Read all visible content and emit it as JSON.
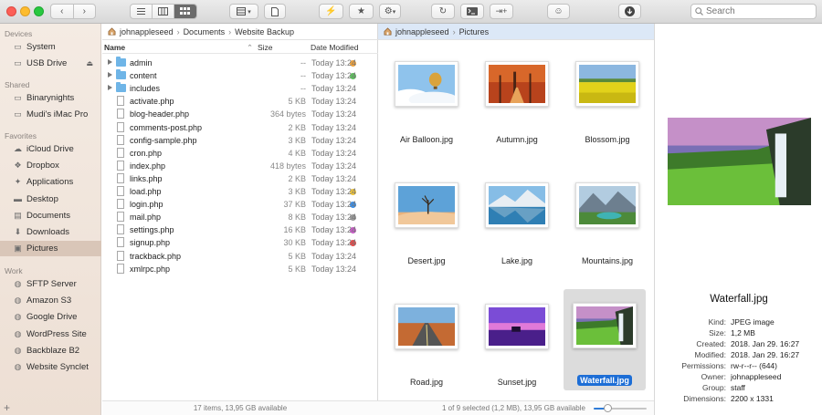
{
  "search": {
    "placeholder": "Search"
  },
  "colors": {
    "accent": "#1d6ed6",
    "sidebar_selected": "#d9c6b8",
    "folder": "#6fb5e7"
  },
  "sidebar": {
    "sections": [
      {
        "label": "Devices",
        "items": [
          {
            "label": "System",
            "icon": "hard-drive-icon"
          },
          {
            "label": "USB Drive",
            "icon": "usb-drive-icon",
            "eject": true
          }
        ]
      },
      {
        "label": "Shared",
        "items": [
          {
            "label": "Binarynights",
            "icon": "display-icon"
          },
          {
            "label": "Mudi's iMac Pro",
            "icon": "display-icon"
          }
        ]
      },
      {
        "label": "Favorites",
        "items": [
          {
            "label": "iCloud Drive",
            "icon": "cloud-icon"
          },
          {
            "label": "Dropbox",
            "icon": "dropbox-icon"
          },
          {
            "label": "Applications",
            "icon": "applications-icon"
          },
          {
            "label": "Desktop",
            "icon": "desktop-icon"
          },
          {
            "label": "Documents",
            "icon": "documents-icon"
          },
          {
            "label": "Downloads",
            "icon": "downloads-icon"
          },
          {
            "label": "Pictures",
            "icon": "pictures-icon",
            "selected": true
          }
        ]
      },
      {
        "label": "Work",
        "items": [
          {
            "label": "SFTP Server",
            "icon": "server-icon"
          },
          {
            "label": "Amazon S3",
            "icon": "server-icon"
          },
          {
            "label": "Google Drive",
            "icon": "server-icon"
          },
          {
            "label": "WordPress Site",
            "icon": "server-icon"
          },
          {
            "label": "Backblaze B2",
            "icon": "server-icon"
          },
          {
            "label": "Website Synclet",
            "icon": "server-icon"
          }
        ]
      }
    ]
  },
  "left_pane": {
    "path": [
      "johnappleseed",
      "Documents",
      "Website Backup"
    ],
    "columns": {
      "name": "Name",
      "size": "Size",
      "date": "Date Modified"
    },
    "rows": [
      {
        "name": "admin",
        "folder": true,
        "size": "--",
        "date": "Today 13:24",
        "tag": "#f0a23a"
      },
      {
        "name": "content",
        "folder": true,
        "size": "--",
        "date": "Today 13:24",
        "tag": "#5cc35c"
      },
      {
        "name": "includes",
        "folder": true,
        "size": "--",
        "date": "Today 13:24",
        "tag": ""
      },
      {
        "name": "activate.php",
        "size": "5 KB",
        "date": "Today 13:24",
        "tag": ""
      },
      {
        "name": "blog-header.php",
        "size": "364 bytes",
        "date": "Today 13:24",
        "tag": ""
      },
      {
        "name": "comments-post.php",
        "size": "2 KB",
        "date": "Today 13:24",
        "tag": ""
      },
      {
        "name": "config-sample.php",
        "size": "3 KB",
        "date": "Today 13:24",
        "tag": ""
      },
      {
        "name": "cron.php",
        "size": "4 KB",
        "date": "Today 13:24",
        "tag": ""
      },
      {
        "name": "index.php",
        "size": "418 bytes",
        "date": "Today 13:24",
        "tag": ""
      },
      {
        "name": "links.php",
        "size": "2 KB",
        "date": "Today 13:24",
        "tag": ""
      },
      {
        "name": "load.php",
        "size": "3 KB",
        "date": "Today 13:24",
        "tag": "#f0c53a"
      },
      {
        "name": "login.php",
        "size": "37 KB",
        "date": "Today 13:24",
        "tag": "#3a8fe8"
      },
      {
        "name": "mail.php",
        "size": "8 KB",
        "date": "Today 13:24",
        "tag": "#9a9a9a"
      },
      {
        "name": "settings.php",
        "size": "16 KB",
        "date": "Today 13:24",
        "tag": "#c85cc8"
      },
      {
        "name": "signup.php",
        "size": "30 KB",
        "date": "Today 13:24",
        "tag": "#e84a4a"
      },
      {
        "name": "trackback.php",
        "size": "5 KB",
        "date": "Today 13:24",
        "tag": ""
      },
      {
        "name": "xmlrpc.php",
        "size": "5 KB",
        "date": "Today 13:24",
        "tag": ""
      }
    ],
    "status": "17 items, 13,95 GB available"
  },
  "right_pane": {
    "path": [
      "johnappleseed",
      "Pictures"
    ],
    "items": [
      {
        "name": "Air Balloon.jpg",
        "thumb": "balloon"
      },
      {
        "name": "Autumn.jpg",
        "thumb": "autumn"
      },
      {
        "name": "Blossom.jpg",
        "thumb": "blossom"
      },
      {
        "name": "Desert.jpg",
        "thumb": "desert"
      },
      {
        "name": "Lake.jpg",
        "thumb": "lake"
      },
      {
        "name": "Mountains.jpg",
        "thumb": "mountains"
      },
      {
        "name": "Road.jpg",
        "thumb": "road"
      },
      {
        "name": "Sunset.jpg",
        "thumb": "sunset"
      },
      {
        "name": "Waterfall.jpg",
        "thumb": "waterfall",
        "selected": true
      }
    ],
    "status": "1 of 9 selected (1,2 MB), 13,95 GB available",
    "zoom_level": 0.25
  },
  "preview": {
    "title": "Waterfall.jpg",
    "info": [
      {
        "key": "Kind:",
        "value": "JPEG image"
      },
      {
        "key": "Size:",
        "value": "1,2 MB"
      },
      {
        "key": "Created:",
        "value": "2018. Jan 29. 16:27"
      },
      {
        "key": "Modified:",
        "value": "2018. Jan 29. 16:27"
      },
      {
        "key": "Permissions:",
        "value": "rw-r--r-- (644)"
      },
      {
        "key": "Owner:",
        "value": "johnappleseed"
      },
      {
        "key": "Group:",
        "value": "staff"
      },
      {
        "key": "Dimensions:",
        "value": "2200 x 1331"
      }
    ]
  }
}
